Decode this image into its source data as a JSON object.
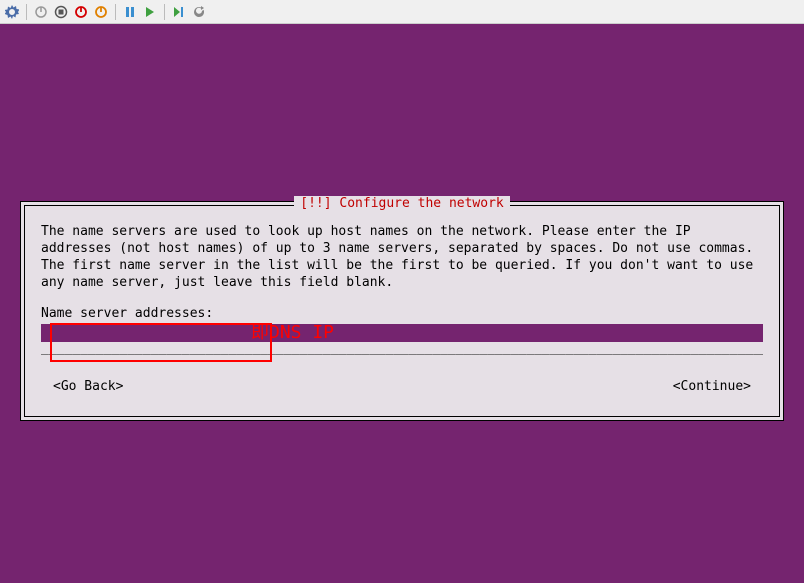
{
  "toolbar": {
    "icons": [
      "settings",
      "power-grey",
      "stop",
      "power-red",
      "power-orange",
      "pause",
      "play",
      "step",
      "refresh"
    ]
  },
  "dialog": {
    "title": "[!!] Configure the network",
    "description": "The name servers are used to look up host names on the network. Please enter the IP addresses (not host names) of up to 3 name servers, separated by spaces. Do not use commas. The first name server in the list will be the first to be queried. If you don't want to use any name server, just leave this field blank.",
    "field_label": "Name server addresses:",
    "input_value": "",
    "go_back_label": "<Go Back>",
    "continue_label": "<Continue>"
  },
  "annotation": {
    "text": "即DNS IP"
  }
}
